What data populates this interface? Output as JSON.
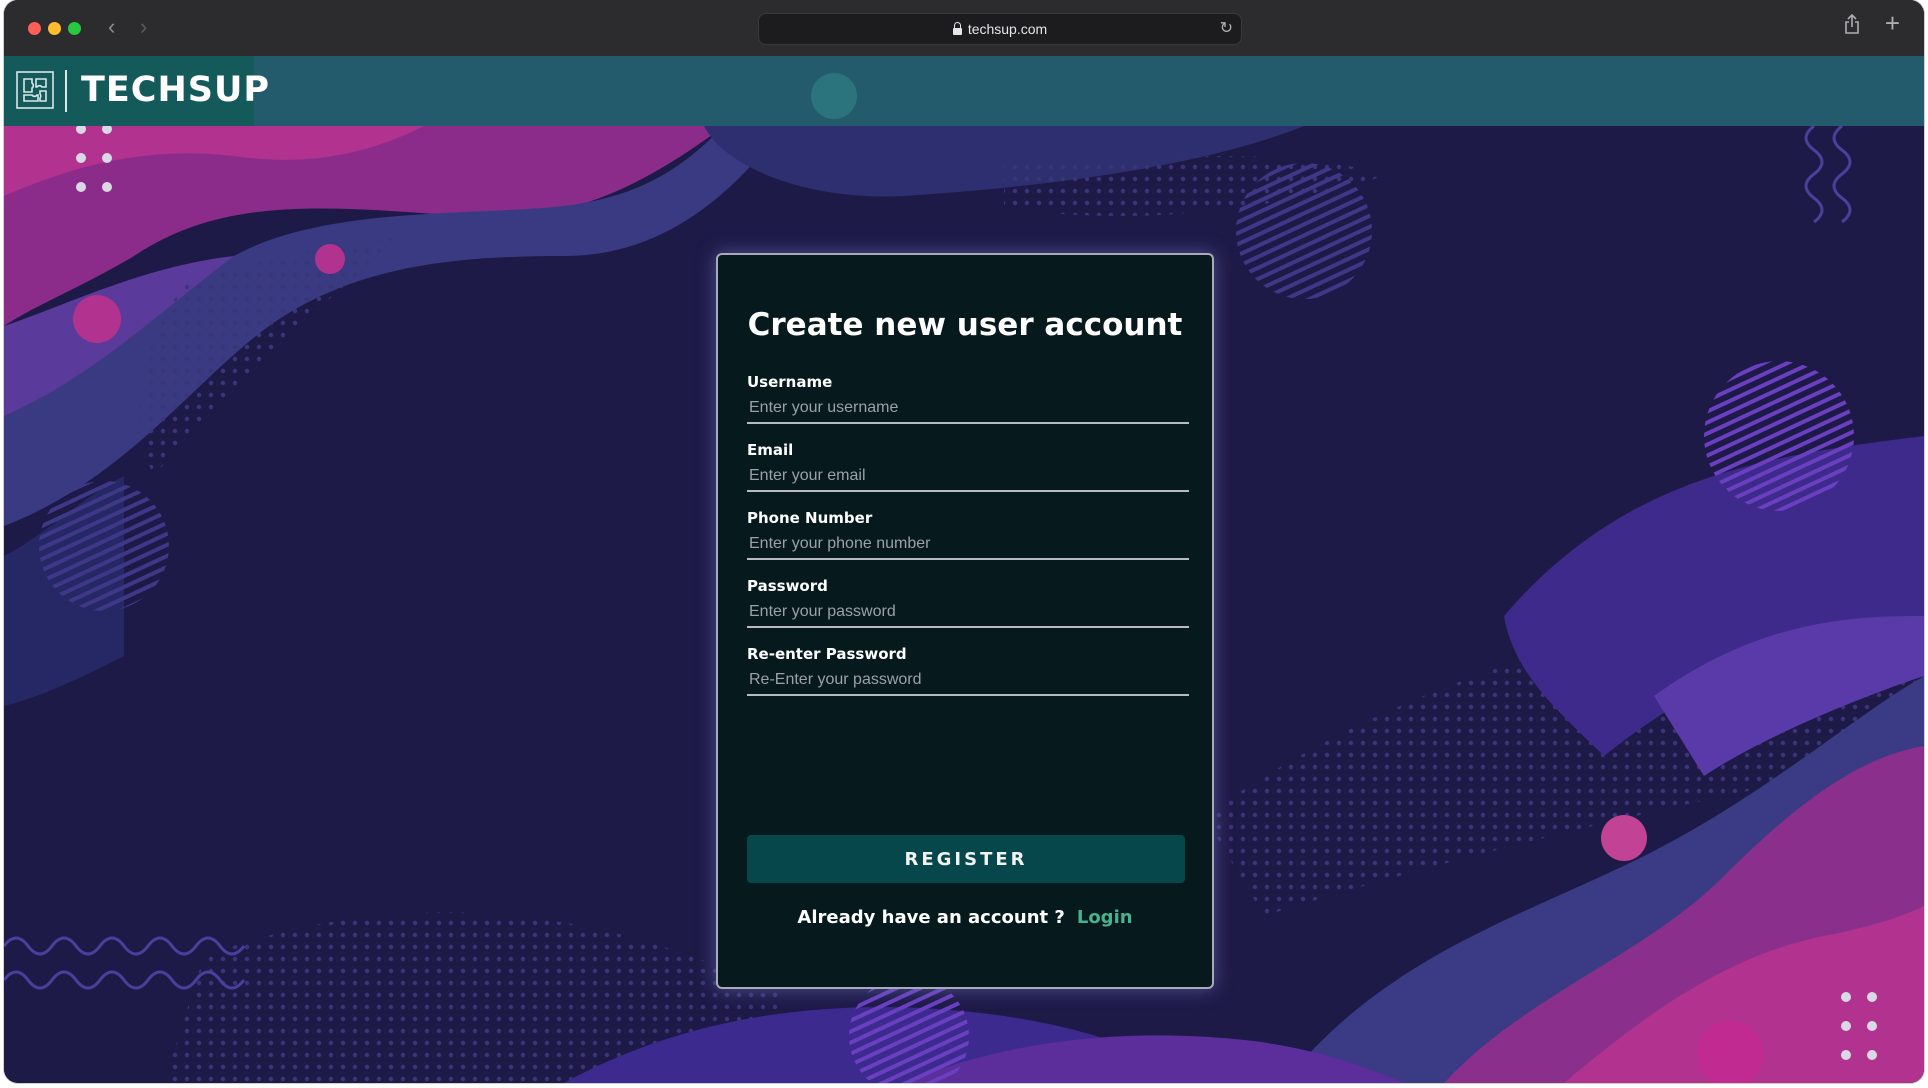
{
  "browser": {
    "url": "techsup.com"
  },
  "brand": {
    "name": "TECHSUP"
  },
  "form": {
    "title": "Create new user account",
    "fields": [
      {
        "label": "Username",
        "placeholder": "Enter your username",
        "value": ""
      },
      {
        "label": "Email",
        "placeholder": "Enter your email",
        "value": ""
      },
      {
        "label": "Phone Number",
        "placeholder": "Enter your phone number",
        "value": ""
      },
      {
        "label": "Password",
        "placeholder": "Enter your password",
        "value": ""
      },
      {
        "label": "Re-enter Password",
        "placeholder": "Re-Enter your password",
        "value": ""
      }
    ],
    "submit_label": "REGISTER",
    "login_prompt": "Already have an account ?",
    "login_link": "Login"
  },
  "colors": {
    "background": "#1e1a48",
    "card": "#061a1e",
    "header": "#266e76",
    "brand_block": "#145a5b",
    "button": "#05474a",
    "link": "#48b28f",
    "accent_magenta": "#b0308f"
  },
  "icons": {
    "logo": "puzzle-icon",
    "lock": "lock-icon",
    "reload": "reload-icon",
    "share": "share-icon",
    "new_tab": "plus-icon"
  }
}
